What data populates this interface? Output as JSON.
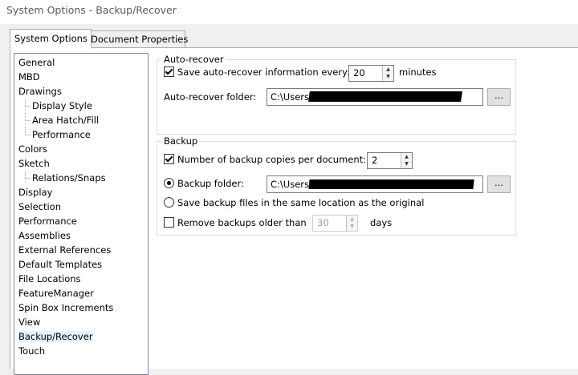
{
  "window": {
    "title": "System Options - Backup/Recover"
  },
  "tabs": [
    {
      "label": "System Options"
    },
    {
      "label": "Document Properties"
    }
  ],
  "tree": {
    "items": [
      {
        "label": "General"
      },
      {
        "label": "MBD"
      },
      {
        "label": "Drawings"
      },
      {
        "label": "Display Style"
      },
      {
        "label": "Area Hatch/Fill"
      },
      {
        "label": "Performance"
      },
      {
        "label": "Colors"
      },
      {
        "label": "Sketch"
      },
      {
        "label": "Relations/Snaps"
      },
      {
        "label": "Display"
      },
      {
        "label": "Selection"
      },
      {
        "label": "Performance"
      },
      {
        "label": "Assemblies"
      },
      {
        "label": "External References"
      },
      {
        "label": "Default Templates"
      },
      {
        "label": "File Locations"
      },
      {
        "label": "FeatureManager"
      },
      {
        "label": "Spin Box Increments"
      },
      {
        "label": "View"
      },
      {
        "label": "Backup/Recover"
      },
      {
        "label": "Touch"
      }
    ]
  },
  "autorecover": {
    "group_title": "Auto-recover",
    "save_label": "Save auto-recover information every:",
    "save_checked": true,
    "interval_value": "20",
    "interval_unit": "minutes",
    "folder_label": "Auto-recover folder:",
    "folder_value": "C:\\Users\\",
    "browse_label": "..."
  },
  "backup": {
    "group_title": "Backup",
    "copies_label": "Number of backup copies per document:",
    "copies_checked": true,
    "copies_value": "2",
    "folder_option_label": "Backup folder:",
    "folder_value": "C:\\Users\\",
    "browse_label": "...",
    "same_location_label": "Save backup files in the same location as the original",
    "remove_label": "Remove backups older than",
    "remove_checked": false,
    "remove_value": "30",
    "remove_unit": "days"
  }
}
